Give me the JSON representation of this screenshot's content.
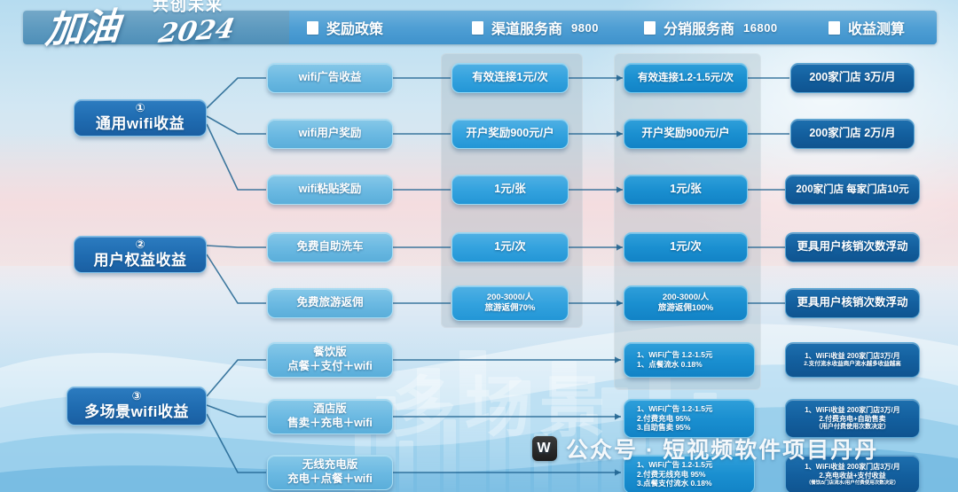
{
  "logo": {
    "main": "加油",
    "sub": "共创未来",
    "year": "2024"
  },
  "header": {
    "nav": [
      {
        "label": "奖励政策",
        "num": ""
      },
      {
        "label": "渠道服务商",
        "num": "9800"
      },
      {
        "label": "分销服务商",
        "num": "16800"
      },
      {
        "label": "收益测算",
        "num": ""
      }
    ]
  },
  "categories": [
    {
      "index": "①",
      "label": "通用wifi收益"
    },
    {
      "index": "②",
      "label": "用户权益收益"
    },
    {
      "index": "③",
      "label": "多场景wifi收益"
    }
  ],
  "policies": [
    {
      "t1": "wifi广告收益",
      "t2": ""
    },
    {
      "t1": "wifi用户奖励",
      "t2": ""
    },
    {
      "t1": "wifi粘贴奖励",
      "t2": ""
    },
    {
      "t1": "免费自助洗车",
      "t2": ""
    },
    {
      "t1": "免费旅游返佣",
      "t2": ""
    },
    {
      "t1": "餐饮版",
      "t2": "点餐＋支付＋wifi"
    },
    {
      "t1": "酒店版",
      "t2": "售卖＋充电＋wifi"
    },
    {
      "t1": "无线充电版",
      "t2": "充电＋点餐＋wifi"
    }
  ],
  "channel": [
    {
      "lines": [
        "有效连接1元/次"
      ]
    },
    {
      "lines": [
        "开户奖励900元/户"
      ]
    },
    {
      "lines": [
        "1元/张"
      ]
    },
    {
      "lines": [
        "1元/次"
      ]
    },
    {
      "lines": [
        "200-3000/人",
        "旅游返佣70%"
      ]
    }
  ],
  "distributor": [
    {
      "lines": [
        "有效连接1.2-1.5元/次"
      ]
    },
    {
      "lines": [
        "开户奖励900元/户"
      ]
    },
    {
      "lines": [
        "1元/张"
      ]
    },
    {
      "lines": [
        "1元/次"
      ]
    },
    {
      "lines": [
        "200-3000/人",
        "旅游返佣100%"
      ]
    }
  ],
  "distributor_detail": [
    {
      "lines": [
        "1、WiFi广告  1.2-1.5元",
        "1、点餐流水  0.18%"
      ]
    },
    {
      "lines": [
        "1、WiFi广告  1.2-1.5元",
        "2.付费充电     95%",
        "3.自助售卖 95%"
      ]
    },
    {
      "lines": [
        "1、WiFi广告  1.2-1.5元",
        "2.付费无线充电   95%",
        "3.点餐支付流水   0.18%"
      ]
    }
  ],
  "revenue": [
    {
      "lines": [
        "200家门店   3万/月"
      ]
    },
    {
      "lines": [
        "200家门店   2万/月"
      ]
    },
    {
      "lines": [
        "200家门店 每家门店10元"
      ]
    },
    {
      "lines": [
        "更具用户核销次数浮动"
      ]
    },
    {
      "lines": [
        "更具用户核销次数浮动"
      ]
    }
  ],
  "revenue_detail": [
    {
      "lines": [
        "1、WiFi收益  200家门店3万/月",
        "2.支付流水收益商户流水越多收益越高"
      ]
    },
    {
      "lines": [
        "1、WiFi收益  200家门店3万/月",
        "2.付费充电+自助售卖",
        "（用户付费使用次数决定）"
      ]
    },
    {
      "lines": [
        "1、WiFi收益  200家门店3万/月",
        "2.充电收益+支付收益",
        "（餐饮ది门店流水/用户付费使用次数决定）"
      ]
    }
  ],
  "watermark": {
    "badge": "W",
    "text": "公众号 · 短视频软件项目丹丹"
  },
  "bigtext": "多场景",
  "colors": {
    "nav_bar": "#4f9fd4",
    "level1": "#1f6bb0",
    "level2": "#6bb9e2",
    "level3": "#33a2de",
    "level4": "#1a8fd0",
    "level5": "#135f9e",
    "wire": "#1f6390"
  }
}
